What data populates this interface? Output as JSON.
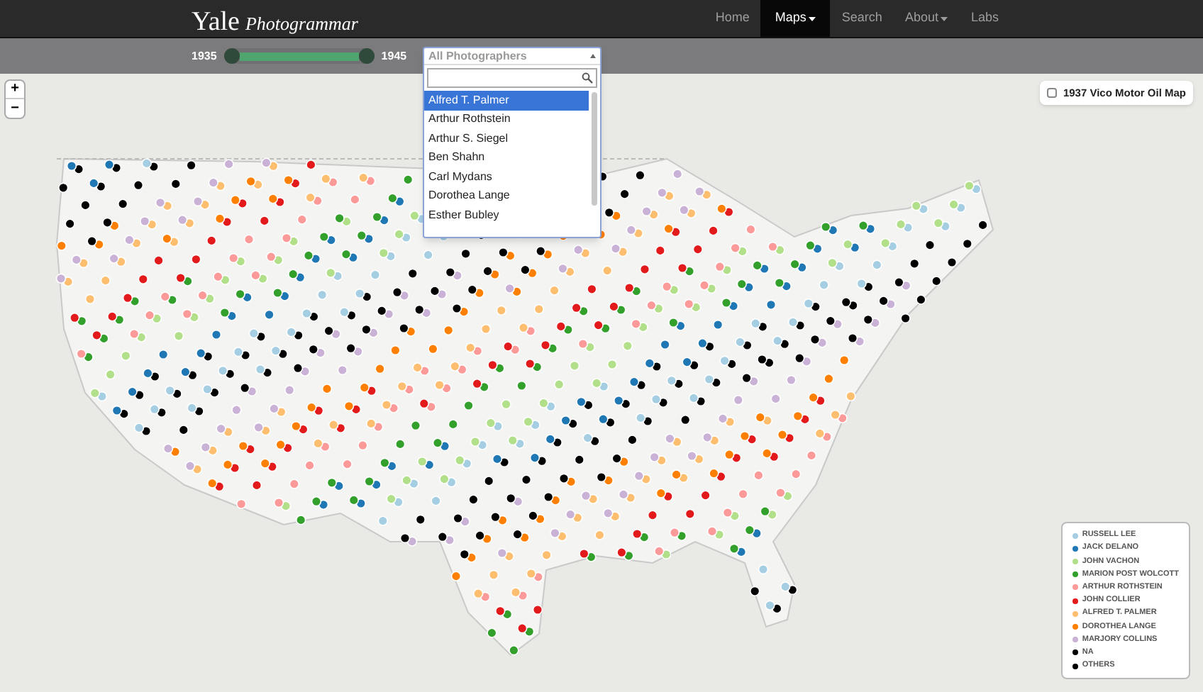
{
  "brand": {
    "name": "Yale",
    "product": "Photogrammar"
  },
  "nav": [
    {
      "label": "Home",
      "selected": false,
      "dropdown": false
    },
    {
      "label": "Maps",
      "selected": true,
      "dropdown": true
    },
    {
      "label": "Search",
      "selected": false,
      "dropdown": false
    },
    {
      "label": "About",
      "selected": false,
      "dropdown": true
    },
    {
      "label": "Labs",
      "selected": false,
      "dropdown": false
    }
  ],
  "year_slider": {
    "start": "1935",
    "end": "1945",
    "handles": [
      {
        "level": 0
      },
      {
        "level": 1
      }
    ]
  },
  "photographer_select": {
    "value": "All Photographers",
    "options": [
      {
        "label": "Alfred T. Palmer",
        "selected": true
      },
      {
        "label": "Arthur Rothstein",
        "selected": false
      },
      {
        "label": "Arthur S. Siegel",
        "selected": false
      },
      {
        "label": "Ben Shahn",
        "selected": false
      },
      {
        "label": "Carl Mydans",
        "selected": false
      },
      {
        "label": "Dorothea Lange",
        "selected": false
      },
      {
        "label": "Esther Bubley",
        "selected": false
      }
    ]
  },
  "zoom": [
    "+",
    "−"
  ],
  "overlay_toggle": {
    "label": "1937 Vico Motor Oil Map",
    "checked": false
  },
  "legend": [
    {
      "label": "RUSSELL LEE",
      "color": "#a6cee3"
    },
    {
      "label": "JACK DELANO",
      "color": "#1f78b4"
    },
    {
      "label": "JOHN VACHON",
      "color": "#b2df8a"
    },
    {
      "label": "MARION POST WOLCOTT",
      "color": "#33a02c"
    },
    {
      "label": "ARTHUR ROTHSTEIN",
      "color": "#fb9a99"
    },
    {
      "label": "JOHN COLLIER",
      "color": "#e31a1c"
    },
    {
      "label": "ALFRED T. PALMER",
      "color": "#fdbf6f"
    },
    {
      "label": "DOROTHEA LANGE",
      "color": "#ff7f00"
    },
    {
      "label": "MARJORY COLLINS",
      "color": "#cab2d6"
    },
    {
      "label": "NA",
      "color": "#000000"
    },
    {
      "label": "OTHERS",
      "color": "#000000"
    }
  ]
}
